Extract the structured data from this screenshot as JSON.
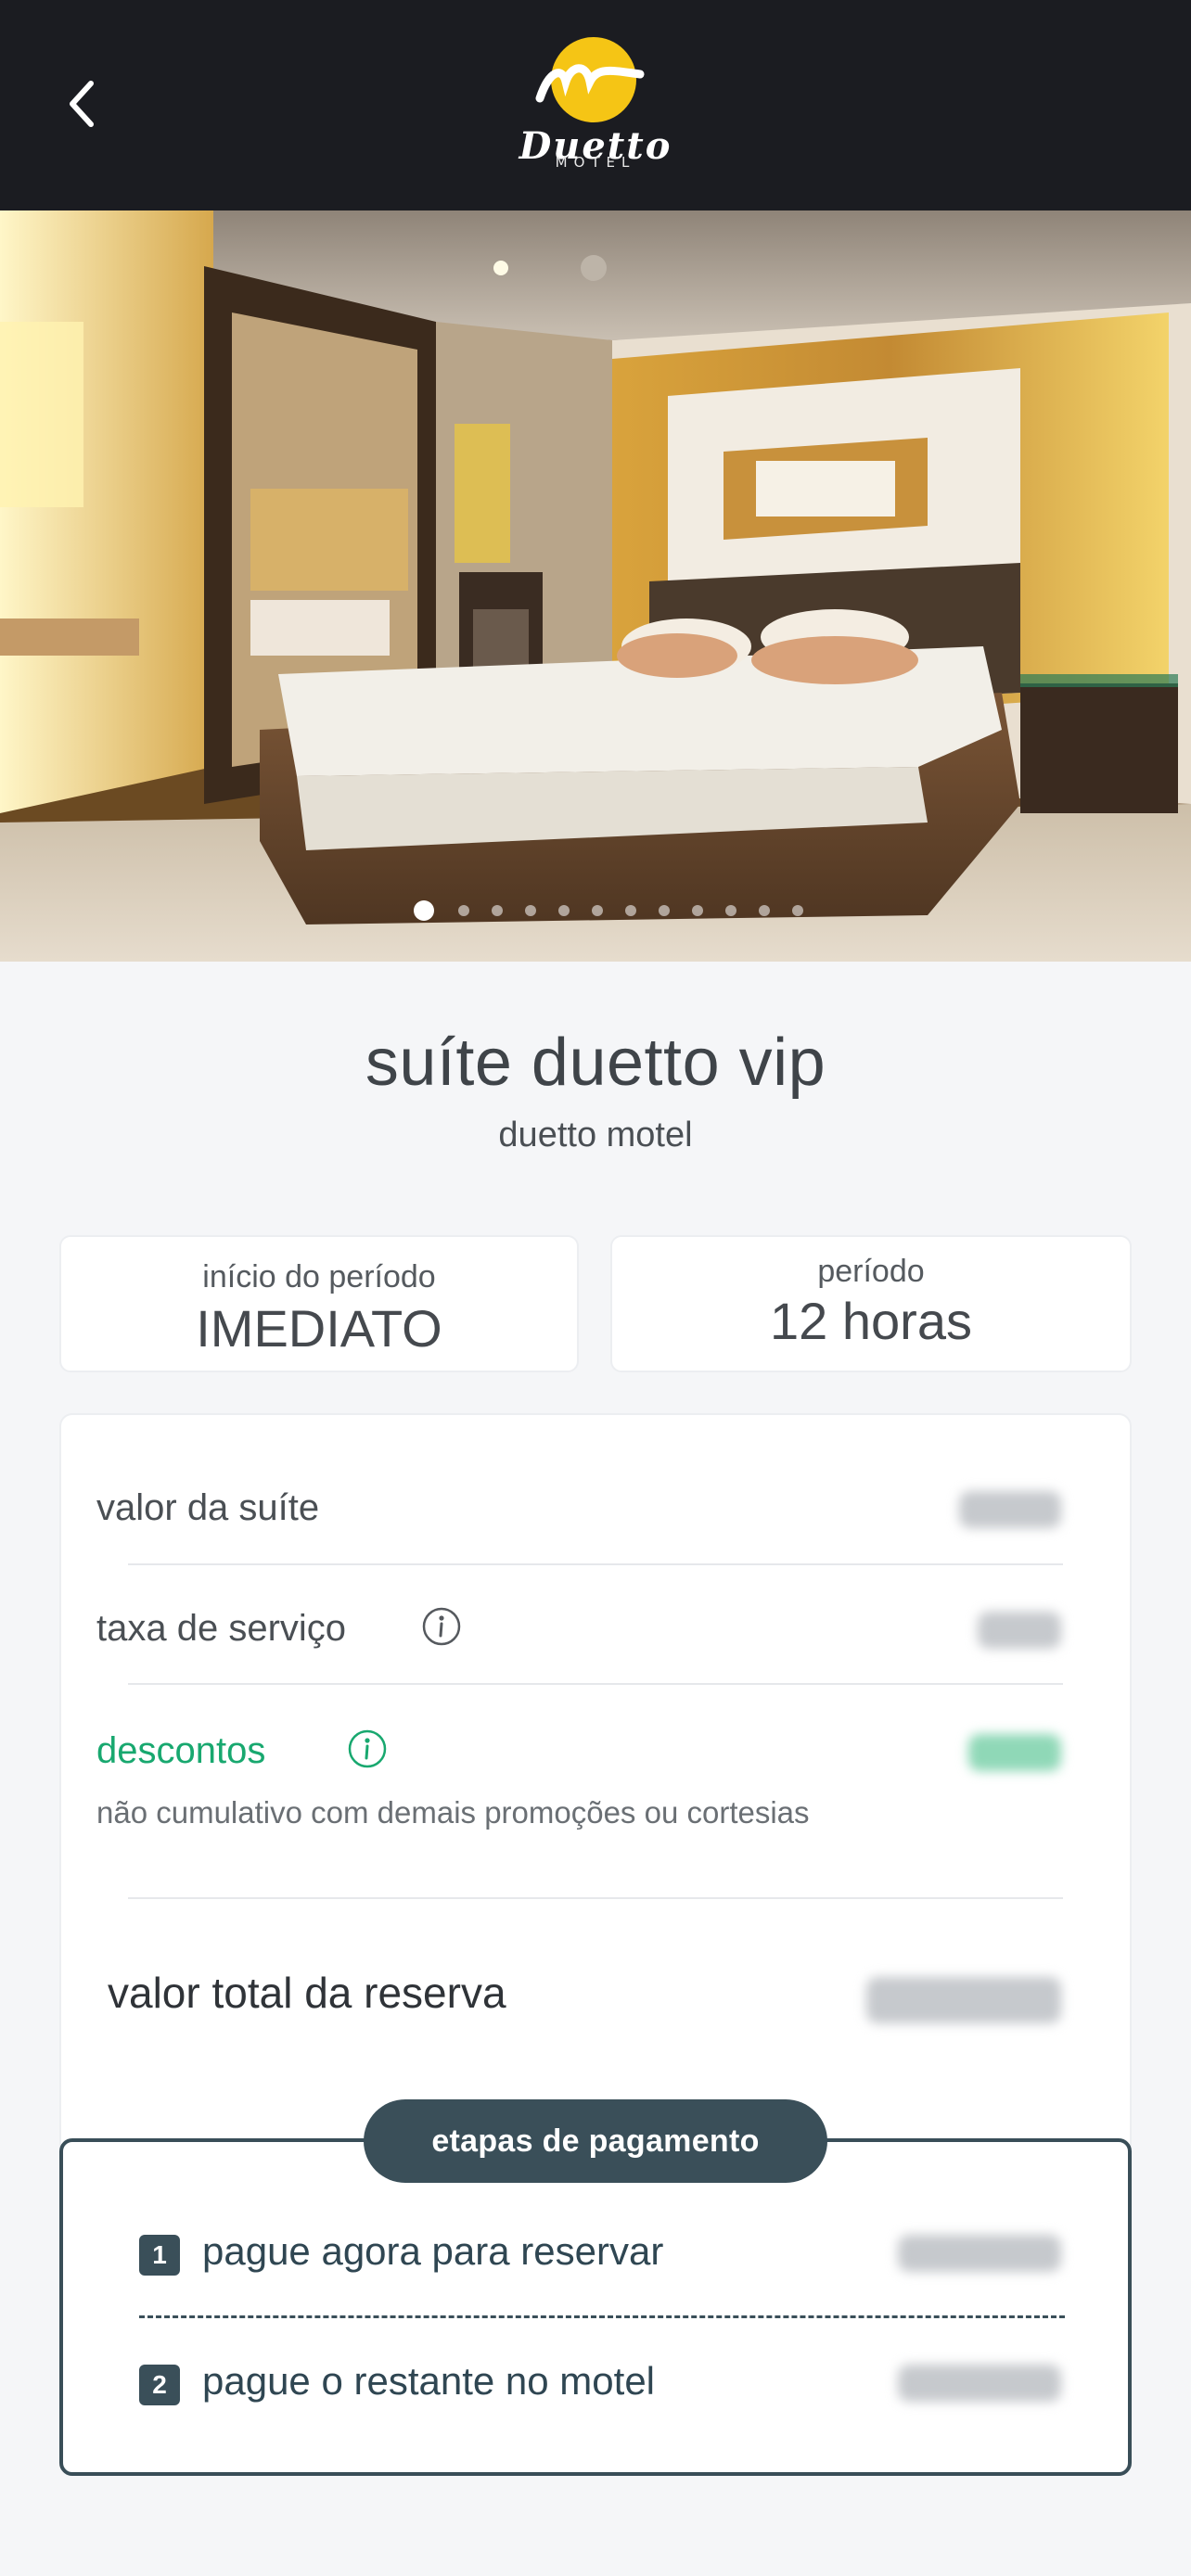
{
  "header": {
    "back_icon": "chevron-left-icon",
    "logo_text": "Duetto",
    "logo_subtext": "MOTEL",
    "accent_color": "#f5c515"
  },
  "gallery": {
    "image_description": "hotel suite with double bed",
    "page_count": 12,
    "active_page": 1
  },
  "suite": {
    "title": "suíte duetto vip",
    "subtitle": "duetto motel"
  },
  "period": {
    "start_label": "início do período",
    "start_value": "IMEDIATO",
    "duration_label": "período",
    "duration_value": "12 horas"
  },
  "summary": {
    "suite_value_label": "valor da suíte",
    "service_fee_label": "taxa de serviço",
    "discounts_label": "descontos",
    "discounts_note": "não cumulativo com demais promoções ou cortesias",
    "total_label": "valor total da reserva",
    "discount_color": "#18a86f"
  },
  "payment_steps": {
    "header": "etapas de pagamento",
    "step1_number": "1",
    "step1_label": "pague agora para reservar",
    "step2_number": "2",
    "step2_label": "pague o restante no motel"
  }
}
